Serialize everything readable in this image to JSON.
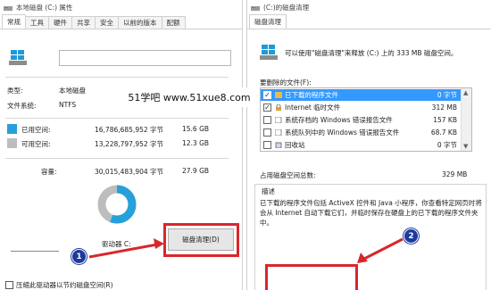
{
  "left": {
    "title": "本地磁盘 (C:) 属性",
    "tabs": [
      "常规",
      "工具",
      "硬件",
      "共享",
      "安全",
      "以前的版本",
      "配额"
    ],
    "type_label": "类型:",
    "type_value": "本地磁盘",
    "fs_label": "文件系统:",
    "fs_value": "NTFS",
    "used_label": "已用空间:",
    "used_bytes": "16,786,685,952 字节",
    "used_gb": "15.6 GB",
    "free_label": "可用空间:",
    "free_bytes": "13,228,797,952 字节",
    "free_gb": "12.3 GB",
    "capacity_label": "容量:",
    "capacity_bytes": "30,015,483,904 字节",
    "capacity_gb": "27.9 GB",
    "used_fraction": 0.559,
    "drive_label": "驱动器 C:",
    "cleanup_button": "磁盘清理(D)",
    "compress_label": "压缩此驱动器以节约磁盘空间(R)",
    "badge": "1"
  },
  "right": {
    "title": "(C:)的磁盘清理",
    "tab": "磁盘清理",
    "intro": "可以使用\"磁盘清理\"来释放 (C:) 上的 333 MB 磁盘空间。",
    "files_label": "要删除的文件(F):",
    "files": [
      {
        "name": "已下载的程序文件",
        "size": "0 字节",
        "checked": true,
        "selected": true
      },
      {
        "name": "Internet 临时文件",
        "size": "312 MB",
        "checked": true,
        "selected": false
      },
      {
        "name": "系统存档的 Windows 错误报告文件",
        "size": "157 KB",
        "checked": false,
        "selected": false
      },
      {
        "name": "系统队列中的 Windows 错误报告文件",
        "size": "68.7 KB",
        "checked": false,
        "selected": false
      },
      {
        "name": "回收站",
        "size": "0 字节",
        "checked": false,
        "selected": false
      }
    ],
    "total_label": "占用磁盘空间总数:",
    "total_value": "329 MB",
    "desc_title": "描述",
    "desc_text": "已下载的程序文件包括 ActiveX 控件和 Java 小程序，你查看特定网页时将会从 Internet 自动下载它们，并临时保存在硬盘上的已下载的程序文件夹中。",
    "badge": "2"
  },
  "watermark": "51学吧 www.51xue8.com",
  "colors": {
    "used": "#26a0da",
    "free": "#bdbdbd",
    "annotation": "#d9262c",
    "badge": "#1d3a9c",
    "selection": "#3399ff"
  }
}
